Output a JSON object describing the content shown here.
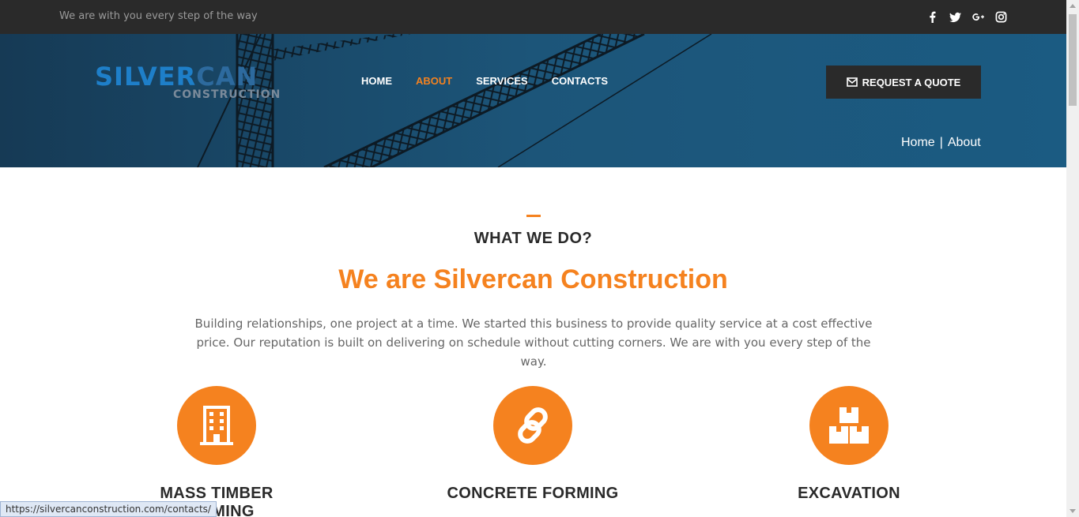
{
  "topbar": {
    "tagline": "We are with you every step of the way",
    "social": [
      {
        "name": "facebook-icon",
        "glyph": "f"
      },
      {
        "name": "twitter-icon",
        "glyph": ""
      },
      {
        "name": "google-plus-icon",
        "glyph": "G+"
      },
      {
        "name": "instagram-icon",
        "glyph": ""
      }
    ]
  },
  "logo": {
    "silver": "SILVER",
    "can": "CAN",
    "sub": "CONSTRUCTION"
  },
  "nav": {
    "items": [
      {
        "label": "HOME"
      },
      {
        "label": "ABOUT",
        "active": true
      },
      {
        "label": "SERVICES"
      },
      {
        "label": "CONTACTS"
      }
    ]
  },
  "quote_button": {
    "label": "REQUEST A QUOTE",
    "icon": "envelope-icon"
  },
  "breadcrumb": {
    "home": "Home",
    "separator": "|",
    "current": "About"
  },
  "intro": {
    "kicker": "WHAT WE DO?",
    "headline": "We are Silvercan Construction",
    "lead": "Building relationships, one project at a time. We started this business to provide quality service at a cost effective price. Our reputation is built on delivering on schedule without cutting corners.  We are with you every step of the way."
  },
  "services": [
    {
      "title": "MASS TIMBER FRAMING",
      "icon": "building-icon"
    },
    {
      "title": "CONCRETE FORMING",
      "icon": "link-icon"
    },
    {
      "title": "EXCAVATION",
      "icon": "boxes-icon"
    }
  ],
  "status_bar": {
    "url": "https://silvercanconstruction.com/contacts/"
  },
  "colors": {
    "accent": "#f5821f",
    "dark": "#2a2a2a",
    "hero": "#1a5a80"
  }
}
